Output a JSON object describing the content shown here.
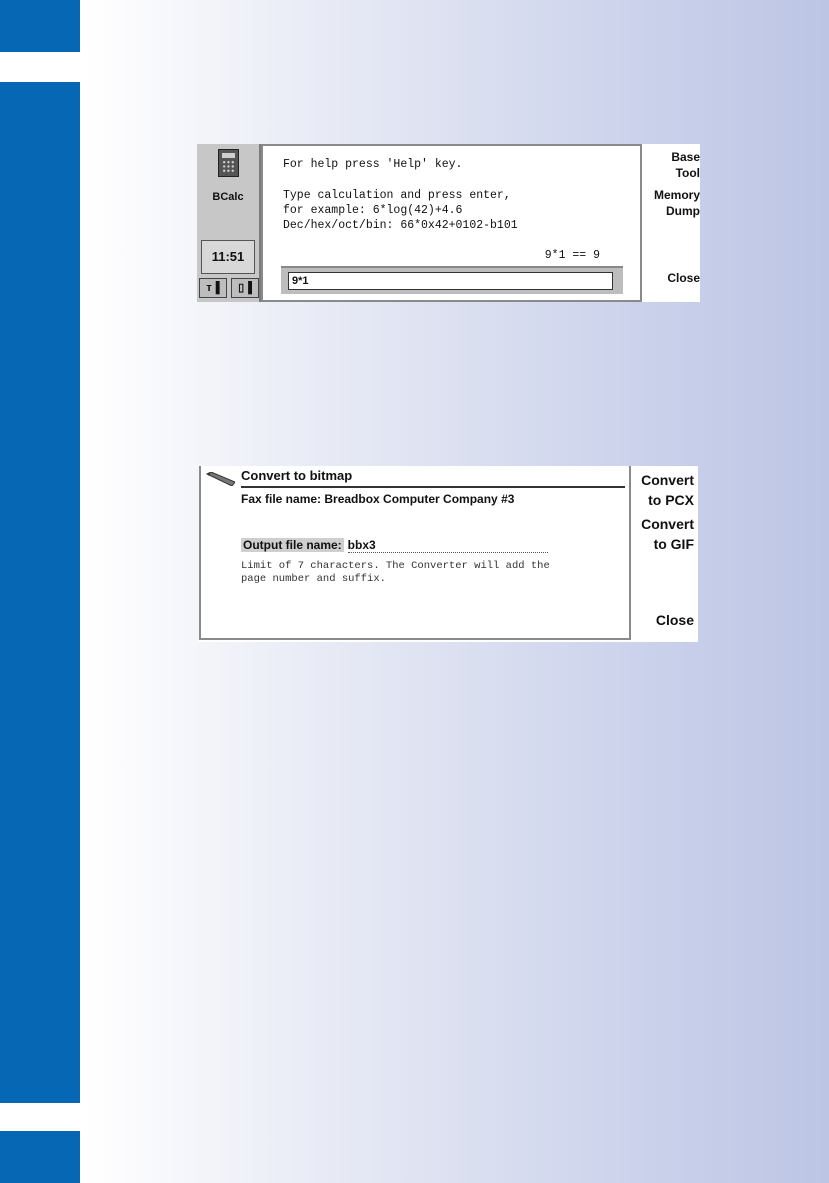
{
  "bcalc": {
    "app_name": "BCalc",
    "clock": "11:51",
    "status_icons": [
      "signal-icon",
      "battery-icon"
    ],
    "lines": [
      "For help press 'Help' key.",
      "Type calculation and press enter,",
      "for example: 6*log(42)+4.6",
      "Dec/hex/oct/bin: 66*0x42+0102-b101"
    ],
    "result": "9*1 == 9",
    "input_value": "9*1",
    "commands": {
      "base": "Base",
      "tool": "Tool",
      "memory": "Memory",
      "dump": "Dump",
      "close": "Close"
    }
  },
  "converter": {
    "title": "Convert to bitmap",
    "fax_label": "Fax file name:",
    "fax_value": "Breadbox Computer Company #3",
    "output_label": "Output file name:",
    "output_value": "bbx3",
    "hint_line1": "Limit of 7 characters. The Converter will add the",
    "hint_line2": "page number and suffix.",
    "commands": {
      "convert_pcx_1": "Convert",
      "convert_pcx_2": "to PCX",
      "convert_gif_1": "Convert",
      "convert_gif_2": "to GIF",
      "close": "Close"
    }
  },
  "colors": {
    "side_bar": "#0668b4"
  }
}
